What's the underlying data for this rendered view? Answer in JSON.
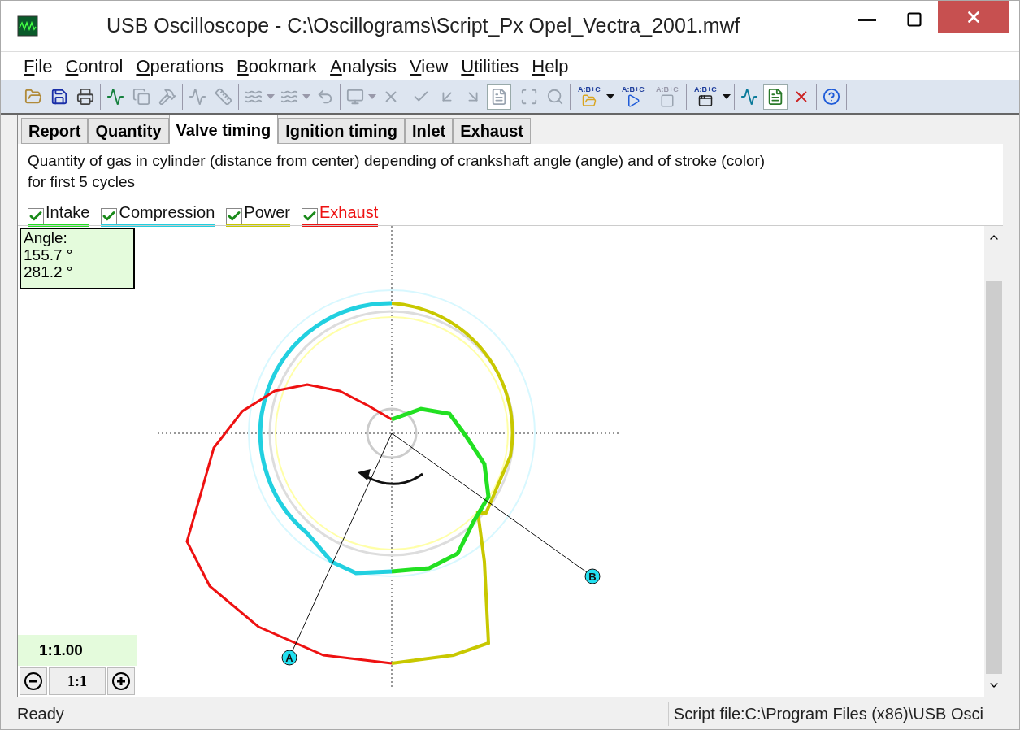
{
  "window": {
    "title": "USB Oscilloscope - C:\\Oscillograms\\Script_Px Opel_Vectra_2001.mwf"
  },
  "menu": [
    "File",
    "Control",
    "Operations",
    "Bookmark",
    "Analysis",
    "View",
    "Utilities",
    "Help"
  ],
  "toolbar": {
    "groups": [
      {
        "buttons": [
          {
            "kind": "open",
            "disabled": false
          },
          {
            "kind": "save",
            "disabled": false
          },
          {
            "kind": "print",
            "disabled": false
          }
        ]
      },
      {
        "buttons": [
          {
            "kind": "savewave",
            "disabled": false
          },
          {
            "kind": "copy",
            "disabled": true
          },
          {
            "kind": "hammer",
            "disabled": true
          }
        ]
      },
      {
        "buttons": [
          {
            "kind": "peak",
            "disabled": true
          },
          {
            "kind": "ruler",
            "disabled": true
          }
        ]
      },
      {
        "buttons": [
          {
            "kind": "cursor",
            "disabled": true,
            "dropdown": true
          },
          {
            "kind": "cursor",
            "disabled": true,
            "dropdown": true
          },
          {
            "kind": "undo",
            "disabled": true
          }
        ]
      },
      {
        "buttons": [
          {
            "kind": "monitor",
            "disabled": true,
            "dropdown": true
          },
          {
            "kind": "delete",
            "disabled": true
          }
        ]
      },
      {
        "buttons": [
          {
            "kind": "check",
            "disabled": true
          },
          {
            "kind": "checkleft",
            "disabled": true
          },
          {
            "kind": "checkright",
            "disabled": true
          },
          {
            "kind": "page",
            "disabled": true,
            "pressed": true
          }
        ]
      },
      {
        "buttons": [
          {
            "kind": "frame",
            "disabled": true
          },
          {
            "kind": "zoom",
            "disabled": true
          }
        ]
      },
      {
        "buttons": [
          {
            "kind": "scriptopen",
            "caption": "A:B+C",
            "disabled": false,
            "dropdown": true
          },
          {
            "kind": "run",
            "caption": "A:B+C",
            "disabled": false
          },
          {
            "kind": "stop",
            "caption": "A:B+C",
            "disabled": true
          }
        ]
      },
      {
        "buttons": [
          {
            "kind": "scriptwindow",
            "caption": "A:B+C",
            "disabled": false,
            "dropdown": true
          }
        ]
      },
      {
        "buttons": [
          {
            "kind": "scope",
            "disabled": false
          },
          {
            "kind": "report",
            "disabled": false,
            "pressed": true
          },
          {
            "kind": "reportdelete",
            "disabled": false
          }
        ]
      },
      {
        "buttons": [
          {
            "kind": "help",
            "disabled": false
          }
        ]
      }
    ]
  },
  "tabs": [
    {
      "label": "Report",
      "selected": false
    },
    {
      "label": "Quantity",
      "selected": false
    },
    {
      "label": "Valve timing",
      "selected": true
    },
    {
      "label": "Ignition timing",
      "selected": false
    },
    {
      "label": "Inlet",
      "selected": false
    },
    {
      "label": "Exhaust",
      "selected": false
    }
  ],
  "description": [
    "Quantity of gas in cylinder (distance from center) depending of crankshaft angle (angle) and of stroke (color)",
    "for first 5 cycles"
  ],
  "legend": [
    {
      "label": "Intake",
      "checked": true,
      "color": "#22e022"
    },
    {
      "label": "Compression",
      "checked": true,
      "color": "#22d0e0"
    },
    {
      "label": "Power",
      "checked": true,
      "color": "#c8c800"
    },
    {
      "label": "Exhaust",
      "checked": true,
      "color": "#ee1111"
    }
  ],
  "angle_panel": {
    "title": "Angle:",
    "values": [
      "155.7 °",
      "281.2 °"
    ]
  },
  "zoom": {
    "ratio": "1:1.00",
    "reset": "1:1"
  },
  "cursors": [
    {
      "label": "A"
    },
    {
      "label": "B"
    }
  ],
  "status_bar": {
    "state": "Ready",
    "script": "Script file:C:\\Program Files (x86)\\USB Osci"
  }
}
